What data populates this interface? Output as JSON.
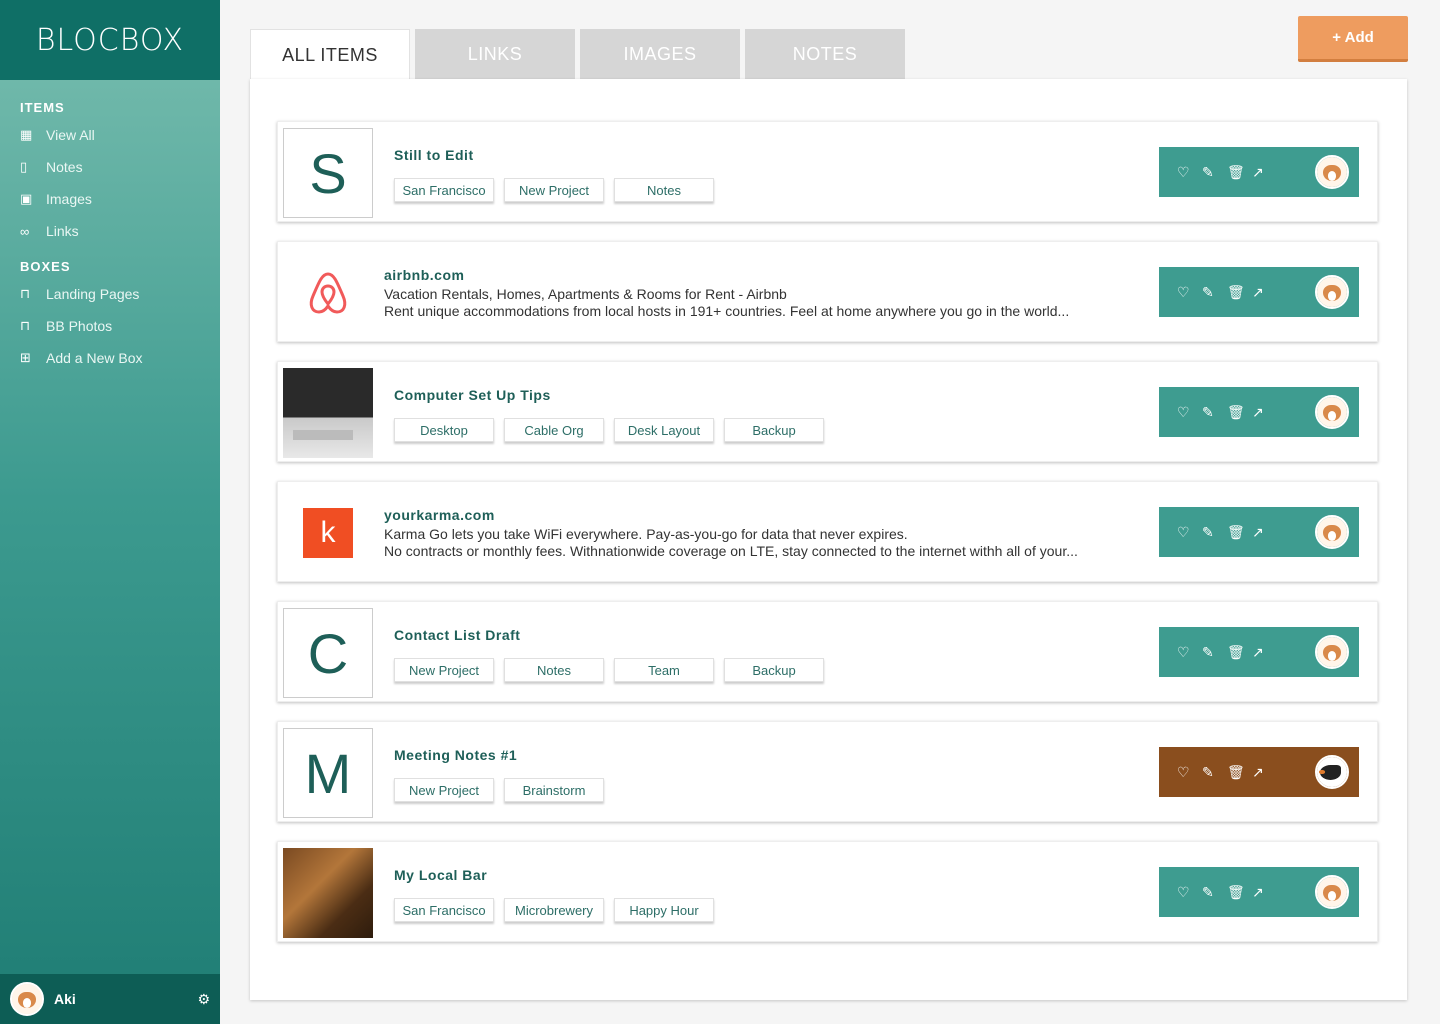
{
  "brand": {
    "logo": "BLOCBOX"
  },
  "sidebar": {
    "items_heading": "ITEMS",
    "items": [
      {
        "label": "View All",
        "icon": "grid-icon"
      },
      {
        "label": "Notes",
        "icon": "file-icon"
      },
      {
        "label": "Images",
        "icon": "image-icon"
      },
      {
        "label": "Links",
        "icon": "link-icon"
      }
    ],
    "boxes_heading": "BOXES",
    "boxes": [
      {
        "label": "Landing Pages",
        "icon": "inbox-icon"
      },
      {
        "label": "BB Photos",
        "icon": "inbox-icon"
      },
      {
        "label": "Add a New Box",
        "icon": "plus-square-icon"
      }
    ],
    "user": {
      "name": "Aki"
    }
  },
  "tabs": [
    {
      "label": "ALL ITEMS",
      "active": true
    },
    {
      "label": "LINKS",
      "active": false
    },
    {
      "label": "IMAGES",
      "active": false
    },
    {
      "label": "NOTES",
      "active": false
    }
  ],
  "add_button": "+ Add",
  "cards": [
    {
      "kind": "note",
      "letter": "S",
      "title": "Still to Edit",
      "tags": [
        "San Francisco",
        "New Project",
        "Notes"
      ]
    },
    {
      "kind": "link",
      "title": "airbnb.com",
      "line1": "Vacation Rentals, Homes, Apartments & Rooms for Rent - Airbnb",
      "line2": "Rent unique accommodations from local hosts in 191+ countries. Feel at home anywhere you go in the world..."
    },
    {
      "kind": "image",
      "title": "Computer Set Up Tips",
      "tags": [
        "Desktop",
        "Cable Org",
        "Desk Layout",
        "Backup"
      ]
    },
    {
      "kind": "link",
      "title": "yourkarma.com",
      "line1": "Karma Go lets you take WiFi everywhere. Pay-as-you-go for data that never expires.",
      "line2": "No contracts or monthly fees. Withnationwide coverage on LTE, stay connected to the internet withh all of your..."
    },
    {
      "kind": "note",
      "letter": "C",
      "title": "Contact List Draft",
      "tags": [
        "New Project",
        "Notes",
        "Team",
        "Backup"
      ]
    },
    {
      "kind": "note",
      "letter": "M",
      "title": "Meeting Notes #1",
      "tags": [
        "New Project",
        "Brainstorm"
      ]
    },
    {
      "kind": "image",
      "title": "My Local Bar",
      "tags": [
        "San Francisco",
        "Microbrewery",
        "Happy Hour"
      ]
    }
  ],
  "colors": {
    "teal": "#3e9c90",
    "brown": "#8a4e1e",
    "orange": "#ee9c5f",
    "sidebar_dark": "#0f6f66"
  }
}
